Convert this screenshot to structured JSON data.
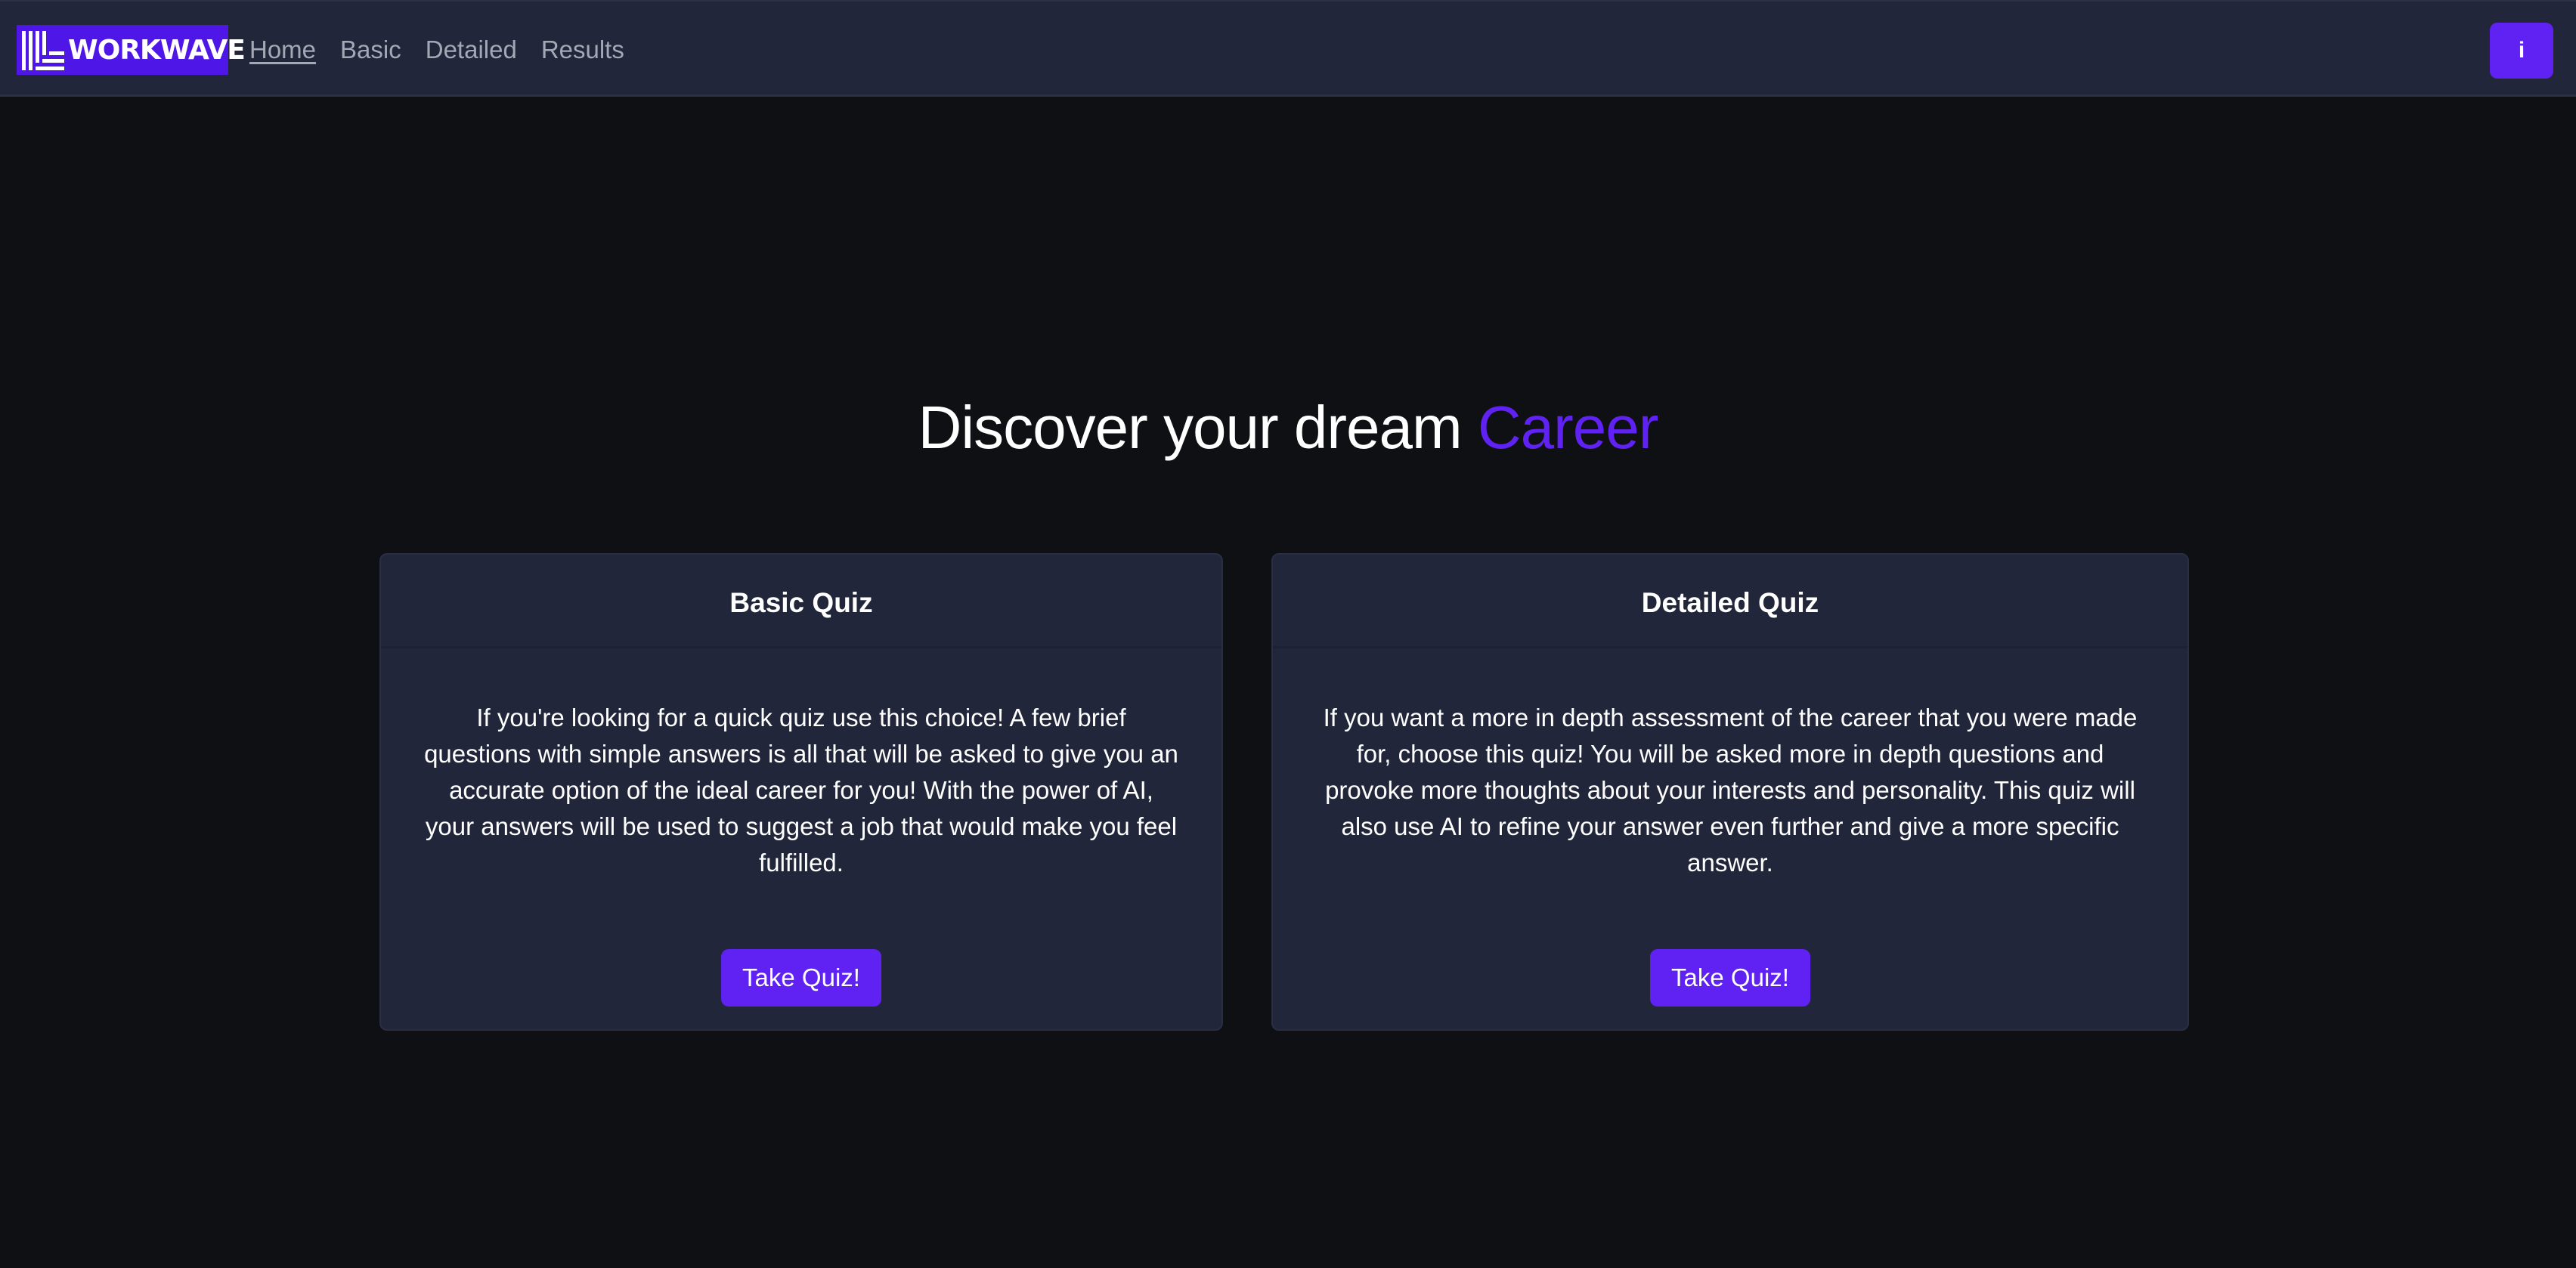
{
  "brand": {
    "name": "WORKWAVE",
    "color": "#4f16e8"
  },
  "nav": {
    "items": [
      {
        "label": "Home",
        "active": true
      },
      {
        "label": "Basic",
        "active": false
      },
      {
        "label": "Detailed",
        "active": false
      },
      {
        "label": "Results",
        "active": false
      }
    ],
    "info_label": "i"
  },
  "hero": {
    "title_prefix": "Discover your dream",
    "title_accent": "Career"
  },
  "cards": [
    {
      "title": "Basic Quiz",
      "text": "If you're looking for a quick quiz use this choice! A few brief questions with simple answers is all that will be asked to give you an accurate option of the ideal career for you! With the power of AI, your answers will be used to suggest a job that would make you feel fulfilled.",
      "button_label": "Take Quiz!"
    },
    {
      "title": "Detailed Quiz",
      "text": "If you want a more in depth assessment of the career that you were made for, choose this quiz! You will be asked more in depth questions and provoke more thoughts about your interests and personality. This quiz will also use AI to refine your answer even further and give a more specific answer.",
      "button_label": "Take Quiz!"
    }
  ],
  "colors": {
    "accent": "#5f22f3",
    "background": "#0f1014",
    "panel": "#22263a"
  }
}
